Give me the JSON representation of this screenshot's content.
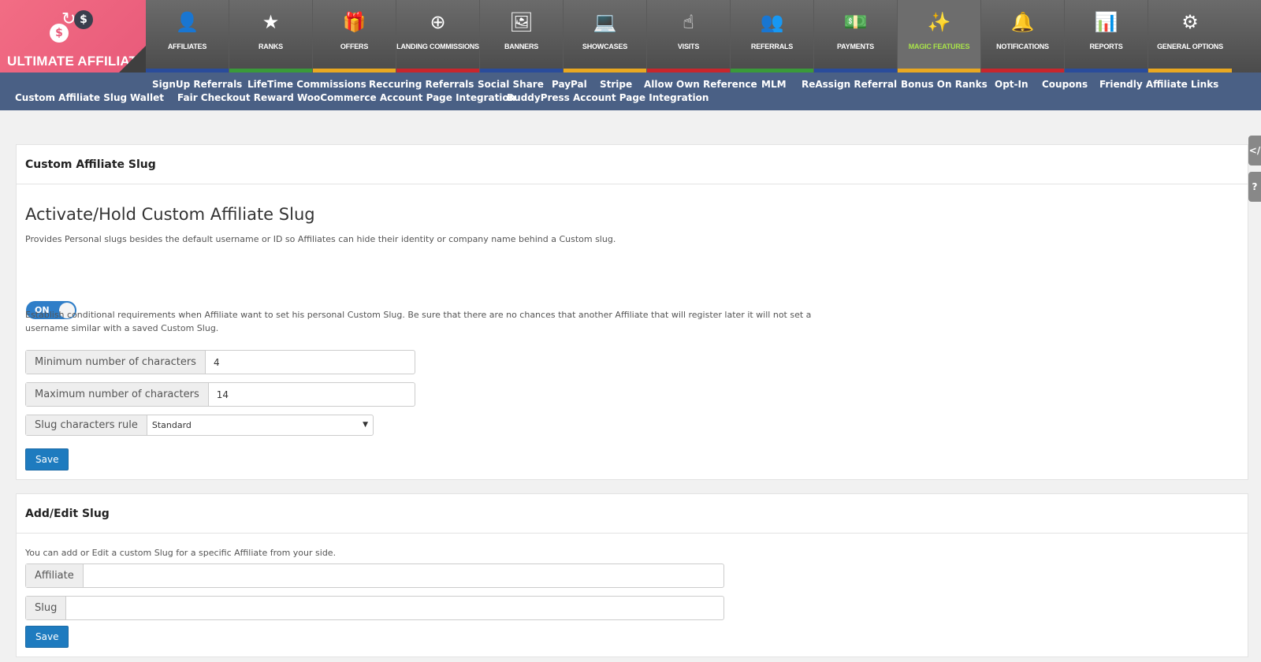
{
  "logo": {
    "text": "ULTIMATE AFFILIATE",
    "coin_left": "$",
    "coin_right": "$"
  },
  "nav": {
    "items": [
      {
        "label": "AFFILIATES",
        "icon": "user-icon",
        "glyph": "👤",
        "bar": "#2a4c9b"
      },
      {
        "label": "RANKS",
        "icon": "star-icon",
        "glyph": "★",
        "bar": "#3a9a3a"
      },
      {
        "label": "OFFERS",
        "icon": "gift-icon",
        "glyph": "🎁",
        "bar": "#e9a821"
      },
      {
        "label": "LANDING COMMISSIONS",
        "icon": "plus-circle-icon",
        "glyph": "⊕",
        "bar": "#c8262d"
      },
      {
        "label": "BANNERS",
        "icon": "image-icon",
        "glyph": "🖼",
        "bar": "#2a4c9b"
      },
      {
        "label": "SHOWCASES",
        "icon": "laptop-icon",
        "glyph": "💻",
        "bar": "#e9a821"
      },
      {
        "label": "VISITS",
        "icon": "pointer-icon",
        "glyph": "☝",
        "bar": "#c8262d"
      },
      {
        "label": "REFERRALS",
        "icon": "group-icon",
        "glyph": "👥",
        "bar": "#3a9a3a"
      },
      {
        "label": "PAYMENTS",
        "icon": "money-icon",
        "glyph": "💵",
        "bar": "#2a4c9b"
      },
      {
        "label": "MAGIC FEATURES",
        "icon": "magic-wand-icon",
        "glyph": "✨",
        "bar": "#e9a821"
      },
      {
        "label": "NOTIFICATIONS",
        "icon": "bell-icon",
        "glyph": "🔔",
        "bar": "#c8262d"
      },
      {
        "label": "REPORTS",
        "icon": "bar-chart-icon",
        "glyph": "📊",
        "bar": "#2a4c9b"
      },
      {
        "label": "GENERAL OPTIONS",
        "icon": "gear-icon",
        "glyph": "⚙",
        "bar": "#e9a821"
      }
    ],
    "active": "MAGIC FEATURES"
  },
  "submenu": {
    "row1": [
      "SignUp Referrals",
      "LifeTime Commissions",
      "Reccuring Referrals",
      "Social Share",
      "PayPal",
      "Stripe",
      "Allow Own Reference",
      "MLM",
      "ReAssign Referral",
      "Bonus On Ranks",
      "Opt-In",
      "Coupons",
      "Friendly Affiliate Links"
    ],
    "row2": [
      "Custom Affiliate Slug",
      "Wallet",
      "Fair Checkout Reward",
      "WooCommerce Account Page Integration",
      "BuddyPress Account Page Integration"
    ]
  },
  "sidetabs": {
    "code": "</",
    "help": "?"
  },
  "panel1": {
    "title": "Custom Affiliate Slug",
    "heading": "Activate/Hold Custom Affiliate Slug",
    "description": "Provides Personal slugs besides the default username or ID so Affiliates can hide their identity or company name behind a Custom slug.",
    "toggle_label": "ON",
    "conditions_line1": "Establish conditional requirements when Affiliate want to set his personal Custom Slug. Be sure that there are no chances that another Affiliate that will register later it will not set a",
    "conditions_line2": "username similar with a saved Custom Slug.",
    "min_label": "Minimum number of characters",
    "min_value": "4",
    "max_label": "Maximum number of characters",
    "max_value": "14",
    "rule_label": "Slug characters rule",
    "rule_value": "Standard",
    "save_label": "Save"
  },
  "panel2": {
    "title": "Add/Edit Slug",
    "description": "You can add or Edit a custom Slug for a specific Affiliate from your side.",
    "affiliate_label": "Affiliate",
    "affiliate_value": "",
    "slug_label": "Slug",
    "slug_value": "",
    "save_label": "Save"
  }
}
